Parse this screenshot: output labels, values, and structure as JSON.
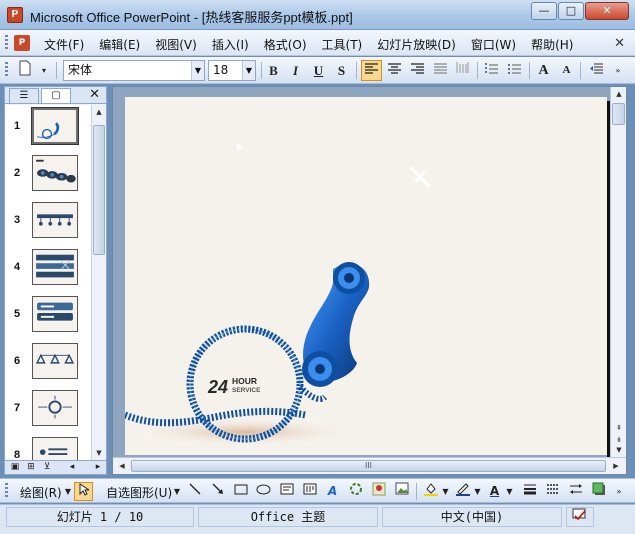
{
  "window": {
    "title": "Microsoft Office PowerPoint - [热线客服服务ppt模板.ppt]",
    "app_icon": "P",
    "min_label": "—",
    "max_label": "□",
    "close_label": "✕"
  },
  "menu": {
    "items": [
      "文件(F)",
      "编辑(E)",
      "视图(V)",
      "插入(I)",
      "格式(O)",
      "工具(T)",
      "幻灯片放映(D)",
      "窗口(W)",
      "帮助(H)"
    ],
    "close": "✕"
  },
  "toolbar": {
    "font_name": "宋体",
    "font_size": "18",
    "bold": "B",
    "italic": "I",
    "underline": "U",
    "shadow": "S",
    "grow_font": "A",
    "shrink_font": "A"
  },
  "left_panel": {
    "tab_outline_icon": "outline-icon",
    "tab_slides_icon": "slides-icon",
    "close": "✕",
    "slide_numbers": [
      "1",
      "2",
      "3",
      "4",
      "5",
      "6",
      "7",
      "8"
    ],
    "selected": 1
  },
  "slide": {
    "badge_big": "24",
    "badge_small_1": "HOUR",
    "badge_small_2": "SERVICE",
    "accent": "#1a5fb4"
  },
  "main_scroll": {
    "grip": "III"
  },
  "drawbar": {
    "draw_label": "绘图(R)",
    "autoshape_label": "自选图形(U)"
  },
  "status": {
    "slide_counter": "幻灯片 1 / 10",
    "theme": "Office 主题",
    "language": "中文(中国)"
  }
}
